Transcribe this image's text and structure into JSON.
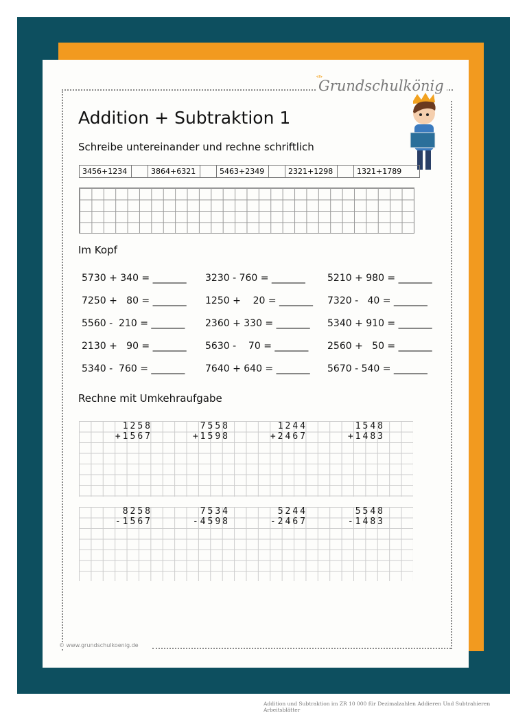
{
  "brand": {
    "logo_text": "Grundschulkönig",
    "footer_url": "© www.grundschulkoenig.de"
  },
  "colors": {
    "background": "#0d4f5f",
    "accent": "#f29a1f",
    "paper": "#fdfdfb"
  },
  "worksheet": {
    "title": "Addition + Subtraktion 1",
    "section1": {
      "heading": "Schreibe untereinander und rechne schriftlich",
      "tasks": [
        "3456+1234",
        "3864+6321",
        "5463+2349",
        "2321+1298",
        "1321+1789"
      ]
    },
    "section2": {
      "heading": "Im Kopf",
      "equations": [
        "5730 + 340 = _______",
        "3230 - 760 = _______",
        "5210 + 980 = _______",
        "7250 +   80 = _______",
        "1250 +    20 = _______",
        "7320 -   40 = _______",
        "5560 -  210 = _______",
        "2360 + 330 = _______",
        "5340 + 910 = _______",
        "2130 +   90 = _______",
        "5630 -    70 = _______",
        "2560 +   50 = _______",
        "5340 -  760 = _______",
        "7640 + 640 = _______",
        "5670 - 540 = _______"
      ]
    },
    "section3": {
      "heading": "Rechne mit Umkehraufgabe",
      "additions": [
        [
          "1258",
          "+1567"
        ],
        [
          "7558",
          "+1598"
        ],
        [
          "1244",
          "+2467"
        ],
        [
          "1548",
          "+1483"
        ]
      ],
      "subtractions": [
        [
          "8258",
          "-1567"
        ],
        [
          "7534",
          "-4598"
        ],
        [
          "5244",
          "-2467"
        ],
        [
          "5548",
          "-1483"
        ]
      ]
    }
  },
  "caption": "Addition und Subtraktion im ZR 10 000 für Dezimalzahlen Addieren Und Subtrahieren Arbeitsblätter"
}
